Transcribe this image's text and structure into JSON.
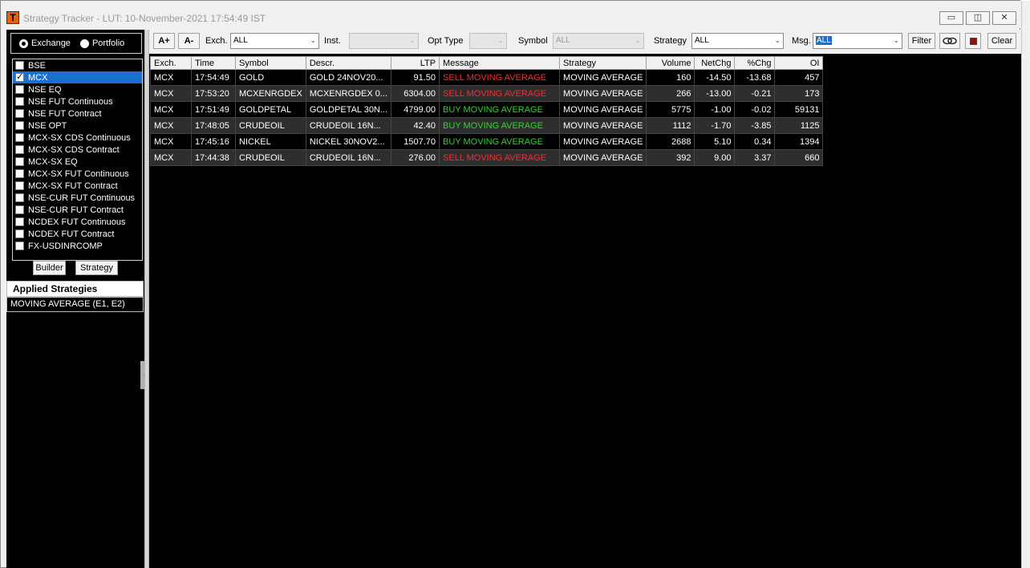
{
  "window": {
    "title": "Strategy Tracker - LUT: 10-November-2021 17:54:49 IST",
    "app_icon_letter": "T",
    "minimize_glyph": "▭",
    "maximize_glyph": "◫",
    "close_glyph": "✕"
  },
  "left_panel": {
    "radio": {
      "exchange_label": "Exchange",
      "portfolio_label": "Portfolio",
      "selected": "Exchange"
    },
    "exchanges": [
      {
        "label": "BSE",
        "checked": false
      },
      {
        "label": "MCX",
        "checked": true
      },
      {
        "label": "NSE EQ",
        "checked": false
      },
      {
        "label": "NSE FUT Continuous",
        "checked": false
      },
      {
        "label": "NSE FUT Contract",
        "checked": false
      },
      {
        "label": "NSE OPT",
        "checked": false
      },
      {
        "label": "MCX-SX CDS Continuous",
        "checked": false
      },
      {
        "label": "MCX-SX CDS Contract",
        "checked": false
      },
      {
        "label": "MCX-SX EQ",
        "checked": false
      },
      {
        "label": "MCX-SX FUT Continuous",
        "checked": false
      },
      {
        "label": "MCX-SX FUT Contract",
        "checked": false
      },
      {
        "label": "NSE-CUR FUT Continuous",
        "checked": false
      },
      {
        "label": "NSE-CUR FUT Contract",
        "checked": false
      },
      {
        "label": "NCDEX FUT Continuous",
        "checked": false
      },
      {
        "label": "NCDEX FUT Contract",
        "checked": false
      },
      {
        "label": "FX-USDINRCOMP",
        "checked": false
      }
    ],
    "builder_label": "Builder",
    "strategy_label": "Strategy",
    "applied_header": "Applied Strategies",
    "applied_item": "MOVING AVERAGE (E1, E2)",
    "collapse_glyph": "‹"
  },
  "toolbar": {
    "font_increase": "A+",
    "font_decrease": "A-",
    "exch_label": "Exch.",
    "exch_value": "ALL",
    "inst_label": "Inst.",
    "inst_value": "",
    "opt_type_label": "Opt Type",
    "opt_type_value": "",
    "symbol_label": "Symbol",
    "symbol_value": "ALL",
    "strategy_label": "Strategy",
    "strategy_value": "ALL",
    "msg_label": "Msg.",
    "msg_value": "ALL",
    "filter_label": "Filter",
    "clear_label": "Clear",
    "dropdown_glyph": "⌄"
  },
  "grid": {
    "columns": [
      "Exch.",
      "Time",
      "Symbol",
      "Descr.",
      "LTP",
      "Message",
      "Strategy",
      "Volume",
      "NetChg",
      "%Chg",
      "OI"
    ],
    "rows": [
      {
        "exch": "MCX",
        "time": "17:54:49",
        "symbol": "GOLD",
        "descr": "GOLD 24NOV20...",
        "ltp": "91.50",
        "message": "SELL MOVING AVERAGE",
        "signal": "sell",
        "strategy": "MOVING AVERAGE",
        "volume": "160",
        "netchg": "-14.50",
        "pctchg": "-13.68",
        "oi": "457"
      },
      {
        "exch": "MCX",
        "time": "17:53:20",
        "symbol": "MCXENRGDEX",
        "descr": "MCXENRGDEX 0...",
        "ltp": "6304.00",
        "message": "SELL MOVING AVERAGE",
        "signal": "sell",
        "strategy": "MOVING AVERAGE",
        "volume": "266",
        "netchg": "-13.00",
        "pctchg": "-0.21",
        "oi": "173"
      },
      {
        "exch": "MCX",
        "time": "17:51:49",
        "symbol": "GOLDPETAL",
        "descr": "GOLDPETAL 30N...",
        "ltp": "4799.00",
        "message": "BUY MOVING AVERAGE",
        "signal": "buy",
        "strategy": "MOVING AVERAGE",
        "volume": "5775",
        "netchg": "-1.00",
        "pctchg": "-0.02",
        "oi": "59131"
      },
      {
        "exch": "MCX",
        "time": "17:48:05",
        "symbol": "CRUDEOIL",
        "descr": "CRUDEOIL 16N...",
        "ltp": "42.40",
        "message": "BUY MOVING AVERAGE",
        "signal": "buy",
        "strategy": "MOVING AVERAGE",
        "volume": "1112",
        "netchg": "-1.70",
        "pctchg": "-3.85",
        "oi": "1125"
      },
      {
        "exch": "MCX",
        "time": "17:45:16",
        "symbol": "NICKEL",
        "descr": "NICKEL 30NOV2...",
        "ltp": "1507.70",
        "message": "BUY MOVING AVERAGE",
        "signal": "buy",
        "strategy": "MOVING AVERAGE",
        "volume": "2688",
        "netchg": "5.10",
        "pctchg": "0.34",
        "oi": "1394"
      },
      {
        "exch": "MCX",
        "time": "17:44:38",
        "symbol": "CRUDEOIL",
        "descr": "CRUDEOIL 16N...",
        "ltp": "276.00",
        "message": "SELL MOVING AVERAGE",
        "signal": "sell",
        "strategy": "MOVING AVERAGE",
        "volume": "392",
        "netchg": "9.00",
        "pctchg": "3.37",
        "oi": "660"
      }
    ]
  },
  "colors": {
    "sell": "#ff2b2b",
    "buy": "#2bd82b",
    "selection": "#1a6fd1",
    "grid_bg": "#000000",
    "app_icon": "#e85f0c"
  }
}
